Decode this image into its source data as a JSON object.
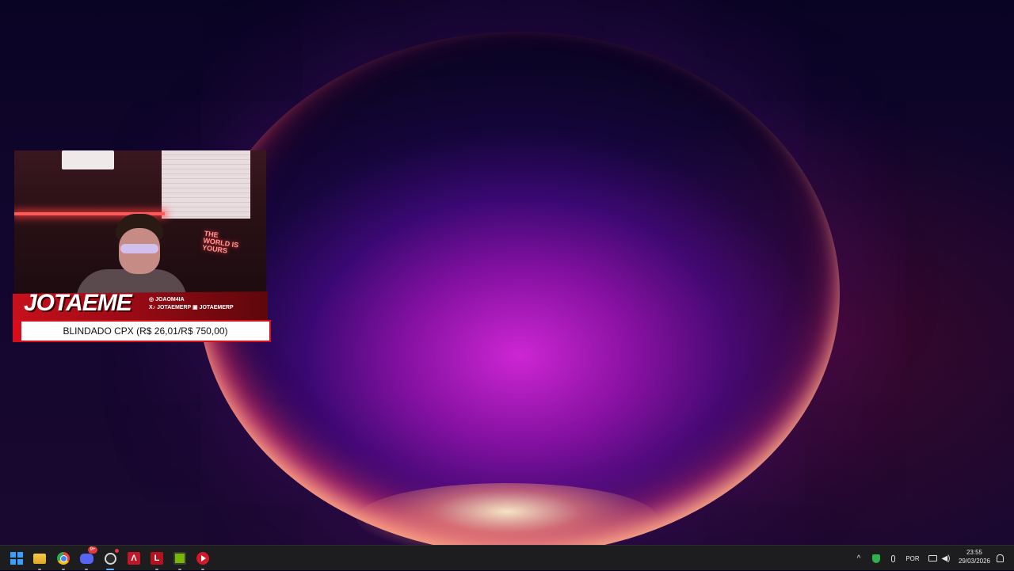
{
  "stream_overlay": {
    "streamer_name": "JOTAEME",
    "socials": {
      "instagram": "JOAOM4IA",
      "x_tiktok": "JOTAEMERP",
      "kick": "JOTAEMERP"
    },
    "neon_sign": "THE WORLD IS YOURS",
    "ticker": "BLINDADO CPX (R$ 26,01/R$ 750,00)"
  },
  "taskbar": {
    "apps": [
      {
        "name": "start",
        "icon": "windows-icon"
      },
      {
        "name": "file-explorer",
        "icon": "folder-icon"
      },
      {
        "name": "chrome",
        "icon": "chrome-icon"
      },
      {
        "name": "discord",
        "icon": "discord-icon",
        "badge": "9+"
      },
      {
        "name": "obs",
        "icon": "obs-icon",
        "active": true
      },
      {
        "name": "app-red-a",
        "icon": "red-a-icon"
      },
      {
        "name": "app-red-l",
        "icon": "red-l-icon"
      },
      {
        "name": "nvidia",
        "icon": "nvidia-icon"
      },
      {
        "name": "media-player",
        "icon": "play-icon"
      }
    ],
    "tray": {
      "language": "POR",
      "time": "23:55",
      "date": "29/03/2026"
    }
  },
  "colors": {
    "accent_red": "#d80d1c",
    "taskbar_bg": "#1d1d1f",
    "windows_blue": "#3aa0ff"
  }
}
